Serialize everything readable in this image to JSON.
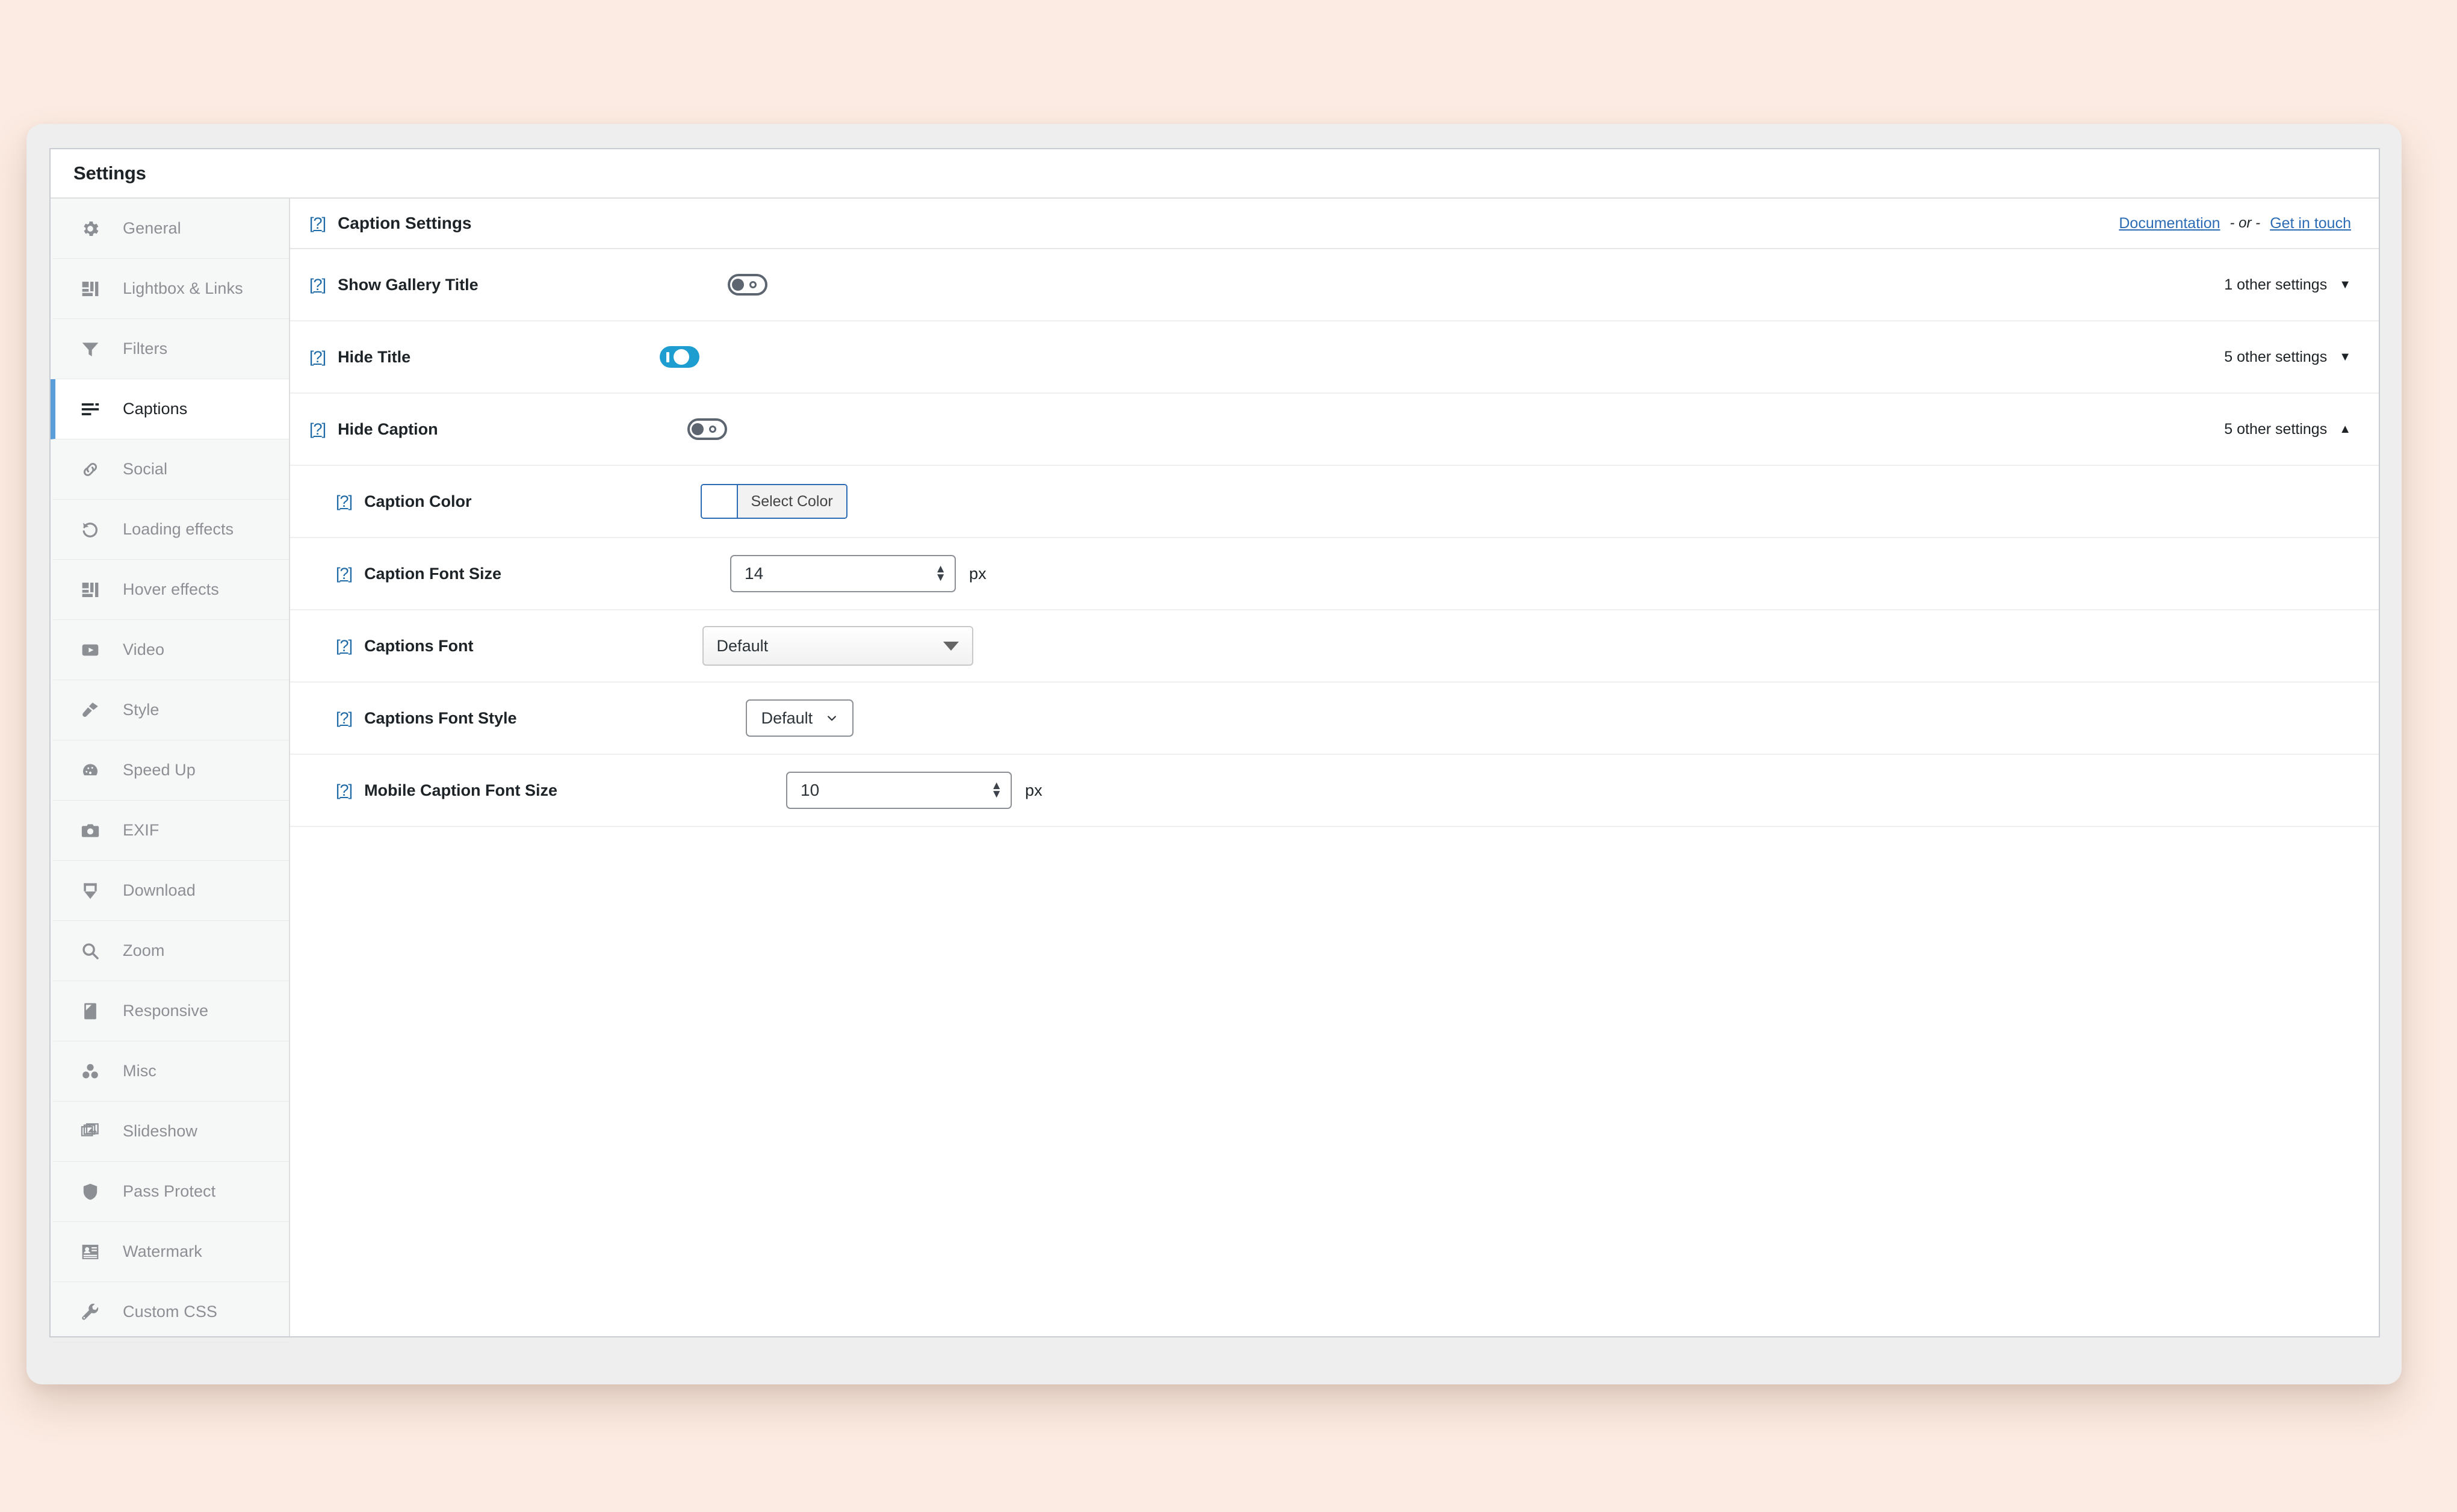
{
  "window": {
    "title": "Settings"
  },
  "sidebar": {
    "items": [
      {
        "label": "General",
        "icon": "gear-icon",
        "active": false
      },
      {
        "label": "Lightbox & Links",
        "icon": "layout-icon",
        "active": false
      },
      {
        "label": "Filters",
        "icon": "funnel-icon",
        "active": false
      },
      {
        "label": "Captions",
        "icon": "caption-lines-icon",
        "active": true
      },
      {
        "label": "Social",
        "icon": "link-chain-icon",
        "active": false
      },
      {
        "label": "Loading effects",
        "icon": "refresh-icon",
        "active": false
      },
      {
        "label": "Hover effects",
        "icon": "layout-icon",
        "active": false
      },
      {
        "label": "Video",
        "icon": "play-icon",
        "active": false
      },
      {
        "label": "Style",
        "icon": "brush-icon",
        "active": false
      },
      {
        "label": "Speed Up",
        "icon": "gauge-icon",
        "active": false
      },
      {
        "label": "EXIF",
        "icon": "camera-icon",
        "active": false
      },
      {
        "label": "Download",
        "icon": "download-icon",
        "active": false
      },
      {
        "label": "Zoom",
        "icon": "magnifier-icon",
        "active": false
      },
      {
        "label": "Responsive",
        "icon": "mobile-icon",
        "active": false
      },
      {
        "label": "Misc",
        "icon": "dots-cluster-icon",
        "active": false
      },
      {
        "label": "Slideshow",
        "icon": "images-stack-icon",
        "active": false
      },
      {
        "label": "Pass Protect",
        "icon": "shield-icon",
        "active": false
      },
      {
        "label": "Watermark",
        "icon": "watermark-icon",
        "active": false
      },
      {
        "label": "Custom CSS",
        "icon": "wrench-icon",
        "active": false
      }
    ]
  },
  "section": {
    "title": "Caption Settings",
    "help_icon": "help-question-icon",
    "links": {
      "documentation": "Documentation",
      "separator": "- or -",
      "contact": "Get in touch"
    }
  },
  "rows": [
    {
      "label": "Show Gallery Title",
      "control": "toggle",
      "value": "off",
      "other_settings": "1 other settings",
      "caret": "▼",
      "expanded": false
    },
    {
      "label": "Hide Title",
      "control": "toggle",
      "value": "on",
      "other_settings": "5 other settings",
      "caret": "▼",
      "expanded": false
    },
    {
      "label": "Hide Caption",
      "control": "toggle",
      "value": "off",
      "other_settings": "5 other settings",
      "caret": "▲",
      "expanded": true
    }
  ],
  "sub_rows": [
    {
      "label": "Caption Color",
      "control": "color",
      "swatch": "#ffffff",
      "button_label": "Select Color"
    },
    {
      "label": "Caption Font Size",
      "control": "number",
      "value": "14",
      "unit": "px"
    },
    {
      "label": "Captions Font",
      "control": "select2",
      "value": "Default"
    },
    {
      "label": "Captions Font Style",
      "control": "select",
      "value": "Default"
    },
    {
      "label": "Mobile Caption Font Size",
      "control": "number",
      "value": "10",
      "unit": "px"
    }
  ],
  "colors": {
    "accent_blue": "#1e9dd1",
    "link_blue": "#2b6cb5",
    "active_border": "#5b9dd9",
    "page_bg": "#fcebe2"
  }
}
